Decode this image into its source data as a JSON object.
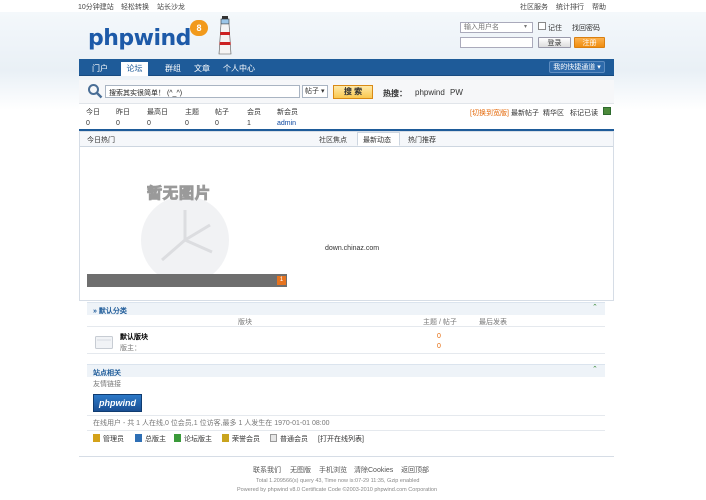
{
  "topbar": {
    "left_links": [
      "10分钟建站",
      "轻松转换",
      "站长沙龙"
    ],
    "right_links": [
      "社区服务",
      "统计排行",
      "帮助"
    ]
  },
  "logo": {
    "text": "phpwind",
    "badge": "8"
  },
  "login": {
    "username_placeholder": "输入用户名",
    "remember_label": "记住",
    "forgot_label": "找回密码",
    "login_button": "登录",
    "register_button": "注册"
  },
  "nav": {
    "items": [
      "门户",
      "论坛",
      "群组",
      "文章",
      "个人中心"
    ],
    "active": "论坛",
    "quick_nav": "我的快捷通道 ▾"
  },
  "search": {
    "value": "搜索其实很简单！ (^_^)",
    "type": "帖子",
    "button": "搜 索",
    "hot_label": "热搜：",
    "hot_terms": [
      "phpwind",
      "PW"
    ]
  },
  "stats": [
    {
      "label": "今日",
      "value": "0"
    },
    {
      "label": "昨日",
      "value": "0"
    },
    {
      "label": "最高日",
      "value": "0"
    },
    {
      "label": "主题",
      "value": "0"
    },
    {
      "label": "帖子",
      "value": "0"
    },
    {
      "label": "会员",
      "value": "1"
    },
    {
      "label": "新会员",
      "value": "admin"
    }
  ],
  "stats_right": {
    "switch": "[切换到宽版]",
    "links": [
      "最新帖子",
      "精华区",
      "标记已读"
    ]
  },
  "hot": {
    "title": "今日热门",
    "tabs": [
      "社区焦点",
      "最新动态",
      "热门推荐"
    ],
    "active_tab": "最新动态",
    "no_image_text": "暂无图片",
    "watermark": "down.chinaz.com",
    "slide_number": "1"
  },
  "category": {
    "title": "» 默认分类",
    "col_block": "版块",
    "col_topics": "主题 / 帖子",
    "col_last": "最后发表",
    "forum_name": "默认版块",
    "moderator": "版主：",
    "topics": "0",
    "posts": "0"
  },
  "site": {
    "title": "站点相关",
    "links_label": "友情链接",
    "link_logo": "phpwind",
    "online_info": "在线用户 - 共  1 人在线,0 位会员,1 位访客,最多  1 人发生在  1970-01-01 08:00"
  },
  "legend": [
    {
      "label": "管理员",
      "color": "#d4a21a"
    },
    {
      "label": "总版主",
      "color": "#2e6fb5"
    },
    {
      "label": "论坛版主",
      "color": "#3a9a3a"
    },
    {
      "label": "荣誉会员",
      "color": "#c9a41e"
    },
    {
      "label": "普通会员",
      "color": "#9a9a9a"
    },
    {
      "label": "[打开在线列表]",
      "color": ""
    }
  ],
  "footer": {
    "links": [
      "联系我们",
      "无图版",
      "手机浏览",
      "清除Cookies",
      "返回顶部"
    ],
    "line1": "Total 1.209566(s) query 43, Time now is:07-29 11:35, Gzip enabled",
    "line2": "Powered by phpwind v8.0 Certificate Code ©2003-2010 phpwind.com Corporation"
  }
}
